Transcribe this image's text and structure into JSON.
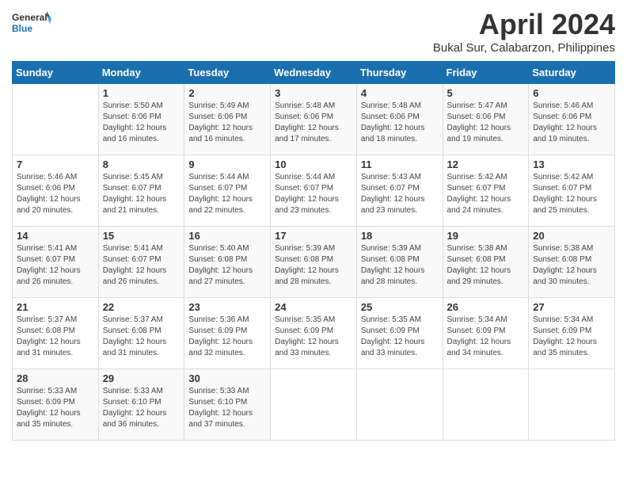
{
  "header": {
    "logo_general": "General",
    "logo_blue": "Blue",
    "month_title": "April 2024",
    "location": "Bukal Sur, Calabarzon, Philippines"
  },
  "days_of_week": [
    "Sunday",
    "Monday",
    "Tuesday",
    "Wednesday",
    "Thursday",
    "Friday",
    "Saturday"
  ],
  "weeks": [
    [
      {
        "day": "",
        "info": ""
      },
      {
        "day": "1",
        "info": "Sunrise: 5:50 AM\nSunset: 6:06 PM\nDaylight: 12 hours\nand 16 minutes."
      },
      {
        "day": "2",
        "info": "Sunrise: 5:49 AM\nSunset: 6:06 PM\nDaylight: 12 hours\nand 16 minutes."
      },
      {
        "day": "3",
        "info": "Sunrise: 5:48 AM\nSunset: 6:06 PM\nDaylight: 12 hours\nand 17 minutes."
      },
      {
        "day": "4",
        "info": "Sunrise: 5:48 AM\nSunset: 6:06 PM\nDaylight: 12 hours\nand 18 minutes."
      },
      {
        "day": "5",
        "info": "Sunrise: 5:47 AM\nSunset: 6:06 PM\nDaylight: 12 hours\nand 19 minutes."
      },
      {
        "day": "6",
        "info": "Sunrise: 5:46 AM\nSunset: 6:06 PM\nDaylight: 12 hours\nand 19 minutes."
      }
    ],
    [
      {
        "day": "7",
        "info": "Sunrise: 5:46 AM\nSunset: 6:06 PM\nDaylight: 12 hours\nand 20 minutes."
      },
      {
        "day": "8",
        "info": "Sunrise: 5:45 AM\nSunset: 6:07 PM\nDaylight: 12 hours\nand 21 minutes."
      },
      {
        "day": "9",
        "info": "Sunrise: 5:44 AM\nSunset: 6:07 PM\nDaylight: 12 hours\nand 22 minutes."
      },
      {
        "day": "10",
        "info": "Sunrise: 5:44 AM\nSunset: 6:07 PM\nDaylight: 12 hours\nand 23 minutes."
      },
      {
        "day": "11",
        "info": "Sunrise: 5:43 AM\nSunset: 6:07 PM\nDaylight: 12 hours\nand 23 minutes."
      },
      {
        "day": "12",
        "info": "Sunrise: 5:42 AM\nSunset: 6:07 PM\nDaylight: 12 hours\nand 24 minutes."
      },
      {
        "day": "13",
        "info": "Sunrise: 5:42 AM\nSunset: 6:07 PM\nDaylight: 12 hours\nand 25 minutes."
      }
    ],
    [
      {
        "day": "14",
        "info": "Sunrise: 5:41 AM\nSunset: 6:07 PM\nDaylight: 12 hours\nand 26 minutes."
      },
      {
        "day": "15",
        "info": "Sunrise: 5:41 AM\nSunset: 6:07 PM\nDaylight: 12 hours\nand 26 minutes."
      },
      {
        "day": "16",
        "info": "Sunrise: 5:40 AM\nSunset: 6:08 PM\nDaylight: 12 hours\nand 27 minutes."
      },
      {
        "day": "17",
        "info": "Sunrise: 5:39 AM\nSunset: 6:08 PM\nDaylight: 12 hours\nand 28 minutes."
      },
      {
        "day": "18",
        "info": "Sunrise: 5:39 AM\nSunset: 6:08 PM\nDaylight: 12 hours\nand 28 minutes."
      },
      {
        "day": "19",
        "info": "Sunrise: 5:38 AM\nSunset: 6:08 PM\nDaylight: 12 hours\nand 29 minutes."
      },
      {
        "day": "20",
        "info": "Sunrise: 5:38 AM\nSunset: 6:08 PM\nDaylight: 12 hours\nand 30 minutes."
      }
    ],
    [
      {
        "day": "21",
        "info": "Sunrise: 5:37 AM\nSunset: 6:08 PM\nDaylight: 12 hours\nand 31 minutes."
      },
      {
        "day": "22",
        "info": "Sunrise: 5:37 AM\nSunset: 6:08 PM\nDaylight: 12 hours\nand 31 minutes."
      },
      {
        "day": "23",
        "info": "Sunrise: 5:36 AM\nSunset: 6:09 PM\nDaylight: 12 hours\nand 32 minutes."
      },
      {
        "day": "24",
        "info": "Sunrise: 5:35 AM\nSunset: 6:09 PM\nDaylight: 12 hours\nand 33 minutes."
      },
      {
        "day": "25",
        "info": "Sunrise: 5:35 AM\nSunset: 6:09 PM\nDaylight: 12 hours\nand 33 minutes."
      },
      {
        "day": "26",
        "info": "Sunrise: 5:34 AM\nSunset: 6:09 PM\nDaylight: 12 hours\nand 34 minutes."
      },
      {
        "day": "27",
        "info": "Sunrise: 5:34 AM\nSunset: 6:09 PM\nDaylight: 12 hours\nand 35 minutes."
      }
    ],
    [
      {
        "day": "28",
        "info": "Sunrise: 5:33 AM\nSunset: 6:09 PM\nDaylight: 12 hours\nand 35 minutes."
      },
      {
        "day": "29",
        "info": "Sunrise: 5:33 AM\nSunset: 6:10 PM\nDaylight: 12 hours\nand 36 minutes."
      },
      {
        "day": "30",
        "info": "Sunrise: 5:33 AM\nSunset: 6:10 PM\nDaylight: 12 hours\nand 37 minutes."
      },
      {
        "day": "",
        "info": ""
      },
      {
        "day": "",
        "info": ""
      },
      {
        "day": "",
        "info": ""
      },
      {
        "day": "",
        "info": ""
      }
    ]
  ]
}
